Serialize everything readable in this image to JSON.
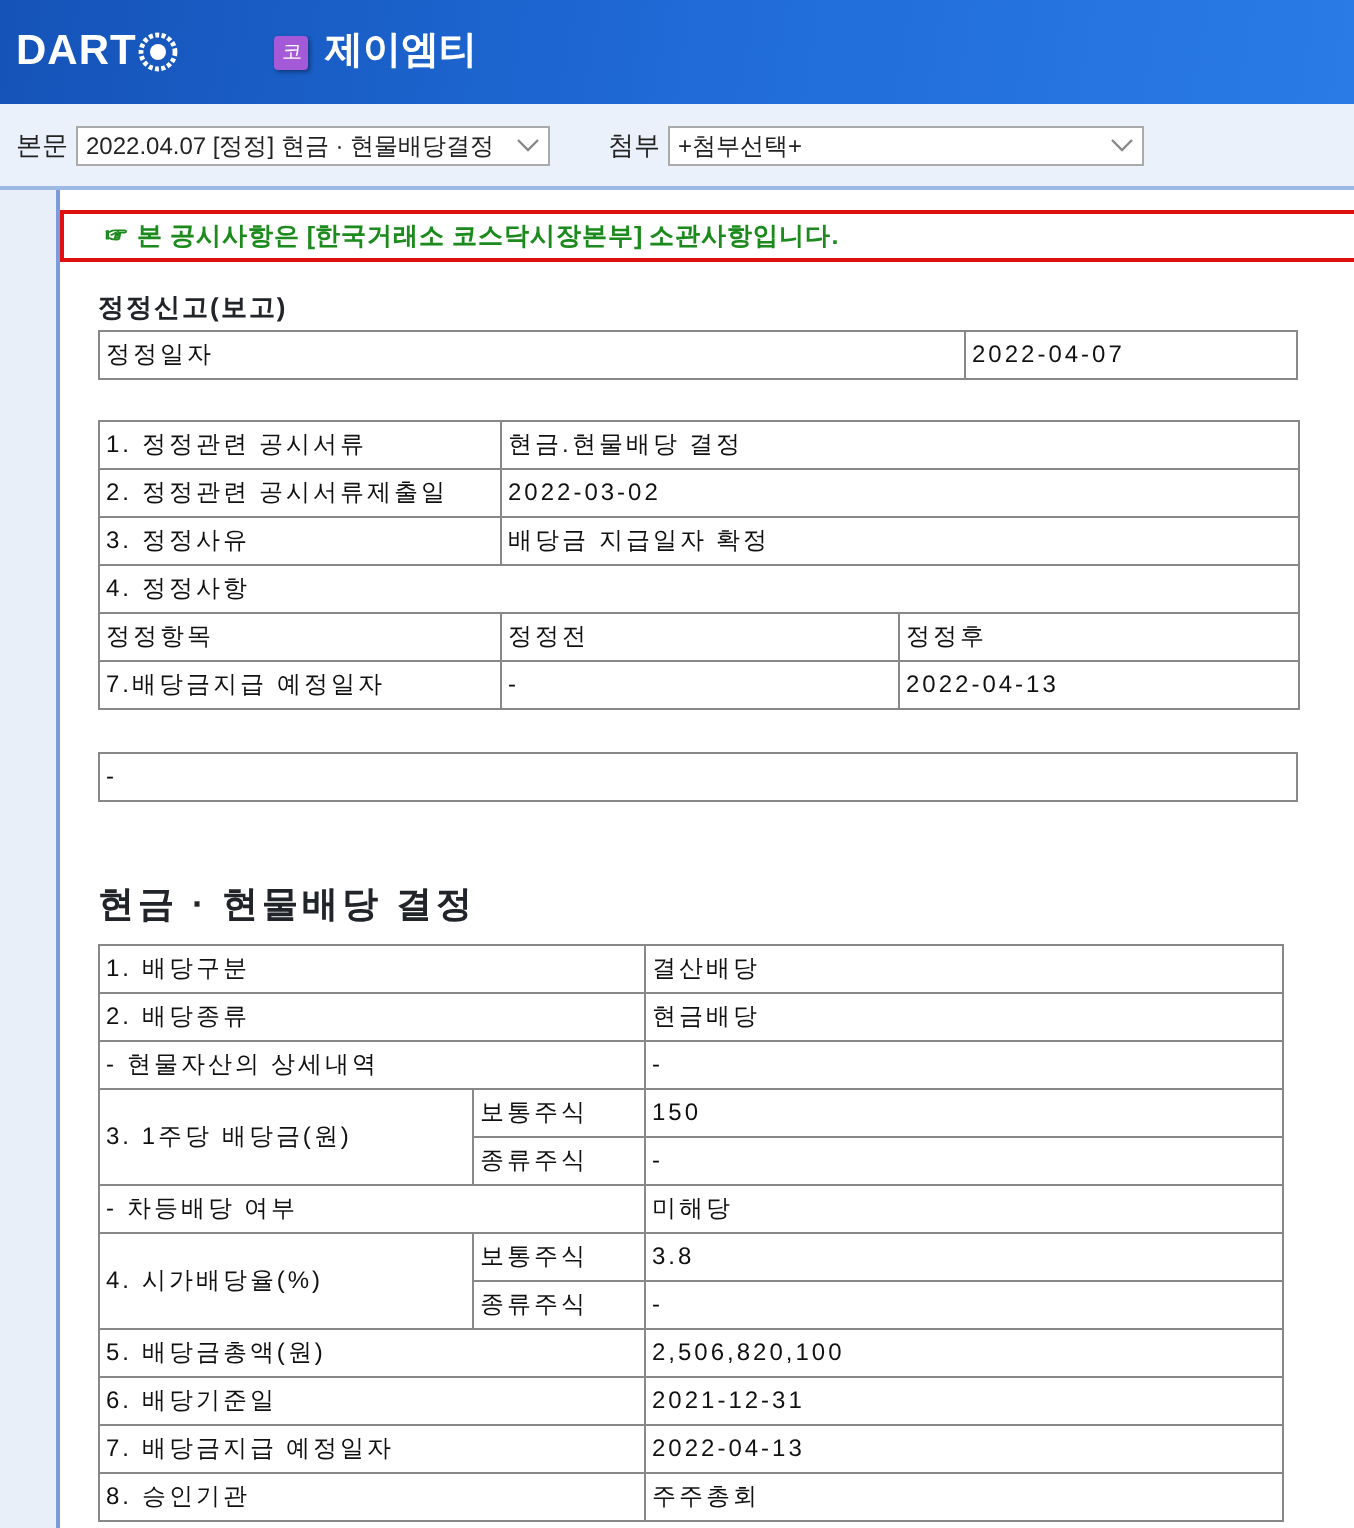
{
  "header": {
    "logo": "DART",
    "company_badge": "코",
    "company_name": "제이엠티"
  },
  "toolbar": {
    "body_label": "본문",
    "body_select": "2022.04.07  [정정] 현금 · 현물배당결정",
    "attach_label": "첨부",
    "attach_select": "+첨부선택+"
  },
  "notice": {
    "icon": "☞",
    "text": "본 공시사항은 [한국거래소 코스닥시장본부] 소관사항입니다."
  },
  "correction": {
    "title": "정정신고(보고)",
    "date_row": {
      "label": "정정일자",
      "value": "2022-04-07"
    },
    "fields": [
      {
        "label": "1. 정정관련 공시서류",
        "value": "현금.현물배당 결정"
      },
      {
        "label": "2. 정정관련 공시서류제출일",
        "value": "2022-03-02"
      },
      {
        "label": "3. 정정사유",
        "value": "배당금 지급일자 확정"
      }
    ],
    "changes": {
      "heading": "4. 정정사항",
      "columns": [
        "정정항목",
        "정정전",
        "정정후"
      ],
      "rows": [
        [
          "7.배당금지급 예정일자",
          "-",
          "2022-04-13"
        ]
      ]
    },
    "note": "-"
  },
  "dividend": {
    "title": "현금 · 현물배당 결정",
    "items": [
      {
        "label": "1. 배당구분",
        "value": "결산배당"
      },
      {
        "label": "2. 배당종류",
        "value": "현금배당"
      },
      {
        "label": "- 현물자산의 상세내역",
        "value": "-"
      },
      {
        "label": "3. 1주당 배당금(원)",
        "parts": [
          {
            "label": "보통주식",
            "value": "150"
          },
          {
            "label": "종류주식",
            "value": "-"
          }
        ]
      },
      {
        "label": "- 차등배당 여부",
        "value": "미해당"
      },
      {
        "label": "4. 시가배당율(%)",
        "parts": [
          {
            "label": "보통주식",
            "value": "3.8"
          },
          {
            "label": "종류주식",
            "value": "-"
          }
        ]
      },
      {
        "label": "5. 배당금총액(원)",
        "value": "2,506,820,100"
      },
      {
        "label": "6. 배당기준일",
        "value": "2021-12-31"
      },
      {
        "label": "7. 배당금지급 예정일자",
        "value": "2022-04-13"
      },
      {
        "label": "8. 승인기관",
        "value": "주주총회"
      }
    ]
  }
}
